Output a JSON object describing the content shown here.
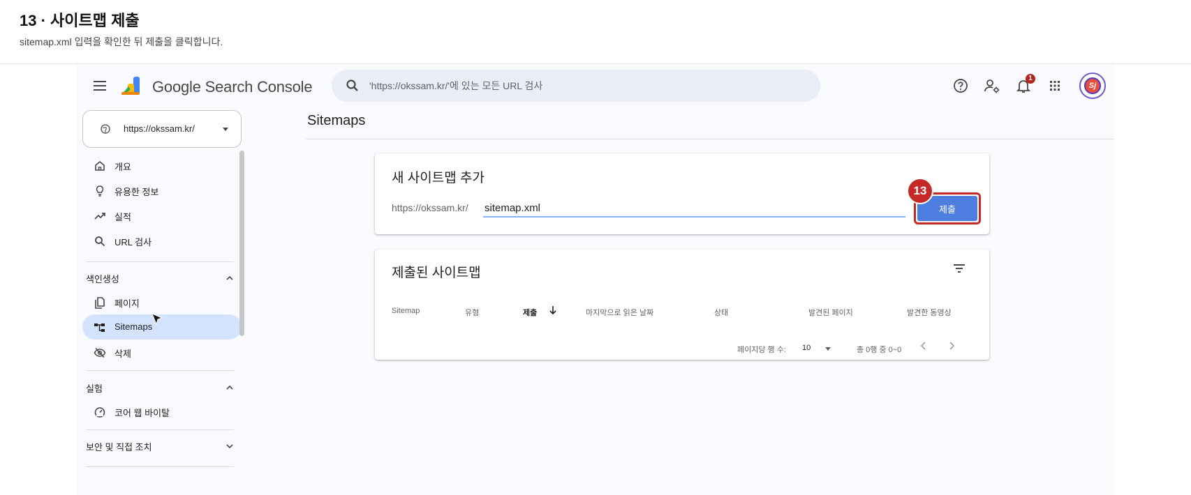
{
  "header": {
    "title": "13 · 사이트맵 제출",
    "subtitle": "sitemap.xml 입력을 확인한 뒤 제출을 클릭합니다."
  },
  "topbar": {
    "app_name": "Google Search Console",
    "search_placeholder": "'https://okssam.kr/'에 있는 모든 URL 검사",
    "notification_count": "1",
    "avatar_initials": "Sj",
    "icons": [
      "menu-icon",
      "search-console-logo",
      "search-icon",
      "help-icon",
      "manage-users-icon",
      "notifications-icon",
      "apps-grid-icon",
      "avatar"
    ]
  },
  "property": {
    "url": "https://okssam.kr/"
  },
  "sidebar": {
    "items": [
      {
        "label": "개요",
        "icon": "home-icon"
      },
      {
        "label": "유용한 정보",
        "icon": "lightbulb-icon"
      },
      {
        "label": "실적",
        "icon": "trending-up-icon"
      },
      {
        "label": "URL 검사",
        "icon": "search-icon"
      }
    ],
    "indexing_section": "색인생성",
    "indexing_items": [
      {
        "label": "페이지",
        "icon": "pages-icon"
      },
      {
        "label": "Sitemaps",
        "icon": "sitemap-icon",
        "active": true
      },
      {
        "label": "삭제",
        "icon": "visibility-off-icon"
      }
    ],
    "experience_section": "실험",
    "experience_items": [
      {
        "label": "코어 웹 바이탈",
        "icon": "speed-icon"
      }
    ],
    "security_section": "보안 및 직접 조치"
  },
  "main": {
    "title": "Sitemaps",
    "add_card": {
      "title": "새 사이트맵 추가",
      "prefix": "https://okssam.kr/",
      "input_value": "sitemap.xml",
      "submit_label": "제출",
      "step_number": "13"
    },
    "submitted_card": {
      "title": "제출된 사이트맵",
      "columns": [
        "Sitemap",
        "유형",
        "제출",
        "마지막으로 읽은 날짜",
        "상태",
        "발견된 페이지",
        "발견한 동영상"
      ],
      "rows_per_page_label": "페이지당 행 수:",
      "rows_per_page_value": "10",
      "range_label": "총 0행 중 0~0"
    }
  },
  "colors": {
    "accent": "#4e7de0",
    "highlight": "#c62828",
    "active_nav": "#d3e3fd"
  }
}
